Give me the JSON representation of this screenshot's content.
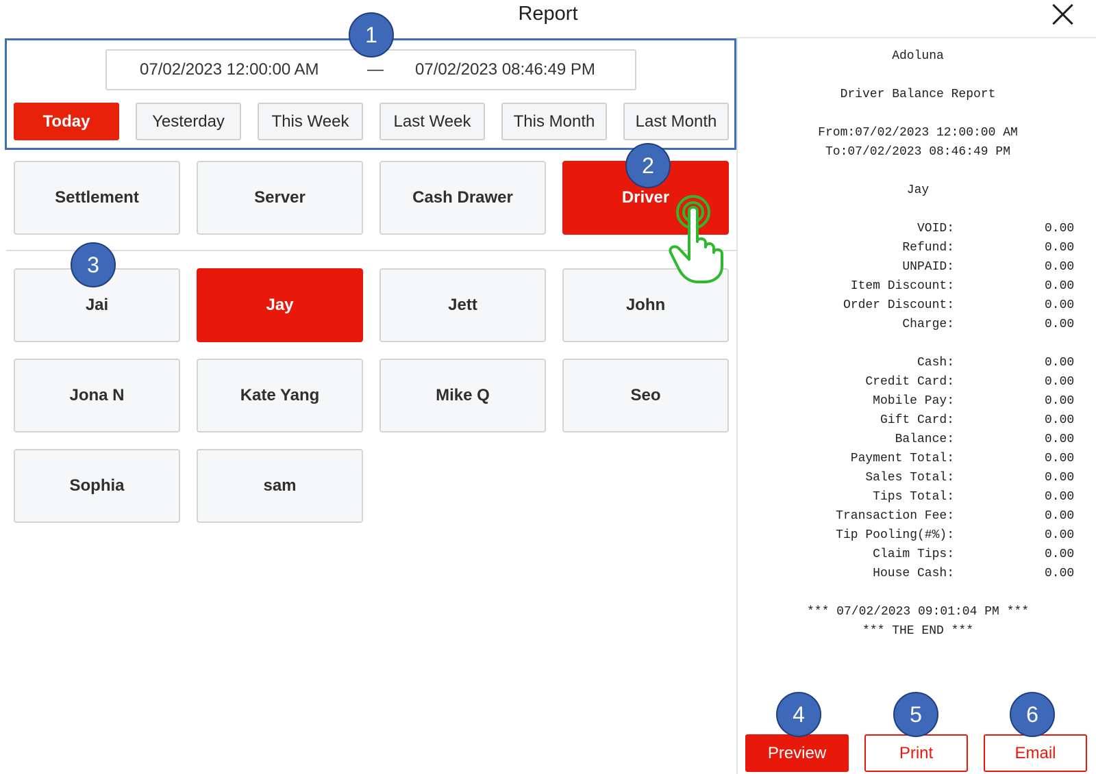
{
  "header": {
    "title": "Report"
  },
  "date_range": {
    "from": "07/02/2023 12:00:00 AM",
    "separator": "—",
    "to": "07/02/2023 08:46:49 PM"
  },
  "quick_ranges": [
    {
      "label": "Today",
      "selected": true
    },
    {
      "label": "Yesterday",
      "selected": false
    },
    {
      "label": "This Week",
      "selected": false
    },
    {
      "label": "Last Week",
      "selected": false
    },
    {
      "label": "This Month",
      "selected": false
    },
    {
      "label": "Last Month",
      "selected": false
    }
  ],
  "report_types": [
    {
      "label": "Settlement",
      "selected": false
    },
    {
      "label": "Server",
      "selected": false
    },
    {
      "label": "Cash Drawer",
      "selected": false
    },
    {
      "label": "Driver",
      "selected": true
    }
  ],
  "drivers": [
    {
      "label": "Jai",
      "selected": false
    },
    {
      "label": "Jay",
      "selected": true
    },
    {
      "label": "Jett",
      "selected": false
    },
    {
      "label": "John",
      "selected": false
    },
    {
      "label": "Jona N",
      "selected": false
    },
    {
      "label": "Kate Yang",
      "selected": false
    },
    {
      "label": "Mike Q",
      "selected": false
    },
    {
      "label": "Seo",
      "selected": false
    },
    {
      "label": "Sophia",
      "selected": false
    },
    {
      "label": "sam",
      "selected": false
    }
  ],
  "badges": [
    "1",
    "2",
    "3",
    "4",
    "5",
    "6"
  ],
  "receipt": {
    "store": "Adoluna",
    "report_title": "Driver Balance Report",
    "from_line": "From:07/02/2023 12:00:00 AM",
    "to_line": "To:07/02/2023 08:46:49 PM",
    "driver": "Jay",
    "rows": [
      {
        "label": "VOID:",
        "value": "0.00"
      },
      {
        "label": "Refund:",
        "value": "0.00"
      },
      {
        "label": "UNPAID:",
        "value": "0.00"
      },
      {
        "label": "Item Discount:",
        "value": "0.00"
      },
      {
        "label": "Order Discount:",
        "value": "0.00"
      },
      {
        "label": "Charge:",
        "value": "0.00"
      },
      {
        "label": "Cash:",
        "value": "0.00"
      },
      {
        "label": "Credit Card:",
        "value": "0.00"
      },
      {
        "label": "Mobile Pay:",
        "value": "0.00"
      },
      {
        "label": "Gift Card:",
        "value": "0.00"
      },
      {
        "label": "Balance:",
        "value": "0.00"
      },
      {
        "label": "Payment Total:",
        "value": "0.00"
      },
      {
        "label": "Sales Total:",
        "value": "0.00"
      },
      {
        "label": "Tips Total:",
        "value": "0.00"
      },
      {
        "label": "Transaction Fee:",
        "value": "0.00"
      },
      {
        "label": "Tip Pooling(#%):",
        "value": "0.00"
      },
      {
        "label": "Claim Tips:",
        "value": "0.00"
      },
      {
        "label": "House Cash:",
        "value": "0.00"
      }
    ],
    "printed_at": "*** 07/02/2023 09:01:04 PM ***",
    "end_line": "*** THE END ***"
  },
  "actions": {
    "preview": "Preview",
    "print": "Print",
    "email": "Email"
  },
  "icons": {
    "close": "close-icon",
    "tap": "tap-hand-icon"
  },
  "colors": {
    "accent_red": "#e8190b",
    "annotation_blue": "#3e68b8",
    "tap_green": "#2eb82e"
  }
}
